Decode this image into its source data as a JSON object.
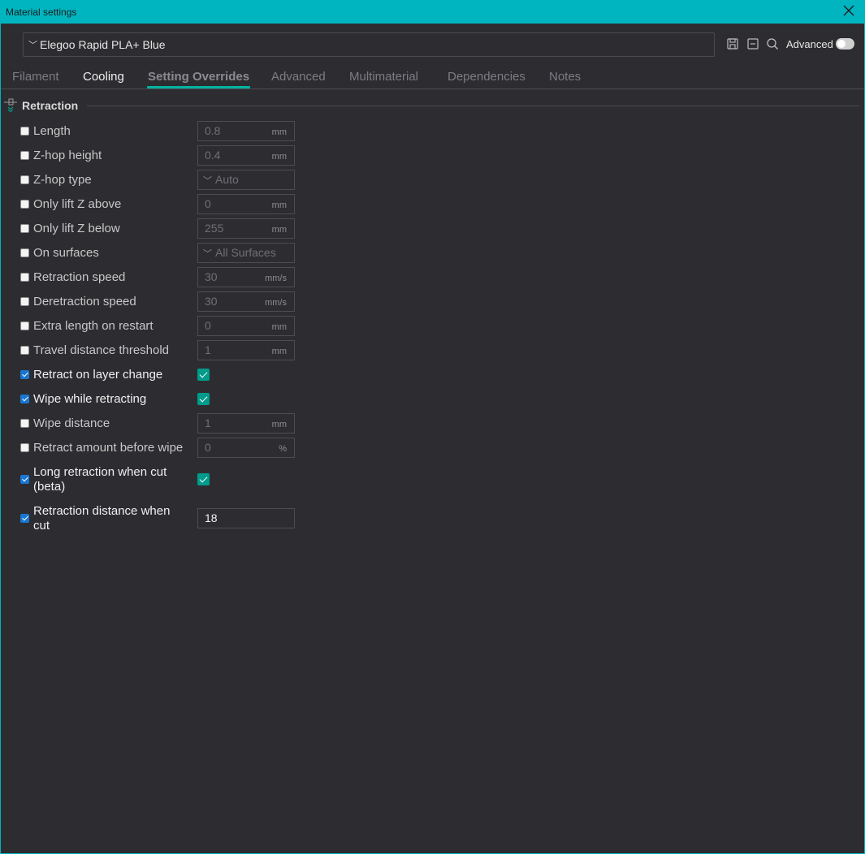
{
  "window": {
    "title": "Material settings"
  },
  "preset": {
    "name": "Elegoo Rapid PLA+ Blue"
  },
  "toolbar": {
    "advanced_label": "Advanced",
    "advanced_enabled": false
  },
  "tabs": [
    {
      "label": "Filament"
    },
    {
      "label": "Cooling"
    },
    {
      "label": "Setting Overrides"
    },
    {
      "label": "Advanced"
    },
    {
      "label": "Multimaterial"
    },
    {
      "label": "Dependencies"
    },
    {
      "label": "Notes"
    }
  ],
  "section": {
    "title": "Retraction"
  },
  "rows": [
    {
      "label": "Length",
      "checked": false,
      "value": "0.8",
      "unit": "mm"
    },
    {
      "label": "Z-hop height",
      "checked": false,
      "value": "0.4",
      "unit": "mm"
    },
    {
      "label": "Z-hop type",
      "checked": false,
      "value": "Auto"
    },
    {
      "label": "Only lift Z above",
      "checked": false,
      "value": "0",
      "unit": "mm"
    },
    {
      "label": "Only lift Z below",
      "checked": false,
      "value": "255",
      "unit": "mm"
    },
    {
      "label": "On surfaces",
      "checked": false,
      "value": "All Surfaces"
    },
    {
      "label": "Retraction speed",
      "checked": false,
      "value": "30",
      "unit": "mm/s"
    },
    {
      "label": "Deretraction speed",
      "checked": false,
      "value": "30",
      "unit": "mm/s"
    },
    {
      "label": "Extra length on restart",
      "checked": false,
      "value": "0",
      "unit": "mm"
    },
    {
      "label": "Travel distance threshold",
      "checked": false,
      "value": "1",
      "unit": "mm"
    },
    {
      "label": "Retract on layer change",
      "checked": true,
      "value": true
    },
    {
      "label": "Wipe while retracting",
      "checked": true,
      "value": true
    },
    {
      "label": "Wipe distance",
      "checked": false,
      "value": "1",
      "unit": "mm"
    },
    {
      "label": "Retract amount before wipe",
      "checked": false,
      "value": "0",
      "unit": "%"
    },
    {
      "label_line1": "Long retraction when cut",
      "label_line2": "(beta)",
      "checked": true,
      "value": true
    },
    {
      "label_line1": "Retraction distance when",
      "label_line2": "cut",
      "checked": true,
      "value": "18"
    }
  ],
  "colors": {
    "accent": "#00b5c0",
    "tab_underline": "#00b4a0",
    "toggle_check": "#009b8a",
    "checkbox_checked": "#1976d2",
    "background": "#2d2d31"
  },
  "icons": [
    "close-icon",
    "chevron-down-icon",
    "save-icon",
    "collapse-icon",
    "search-icon",
    "section-collapse-icon"
  ]
}
